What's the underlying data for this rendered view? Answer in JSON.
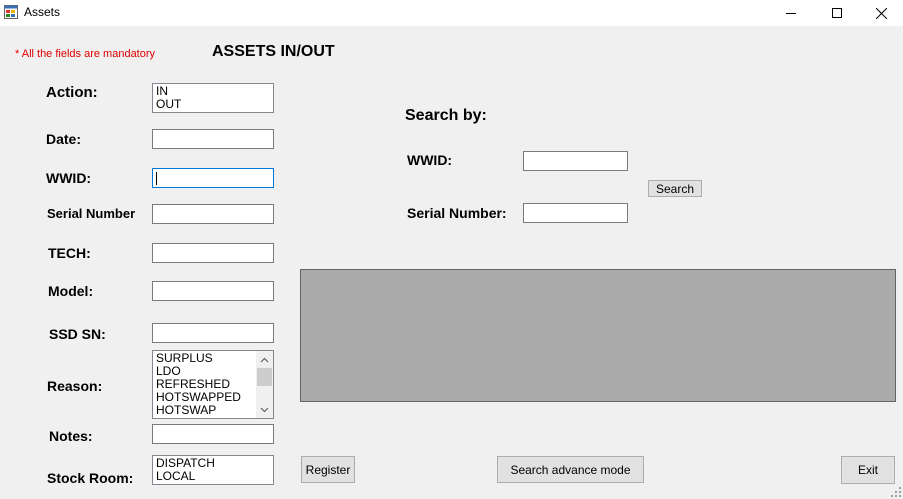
{
  "window": {
    "title": "Assets"
  },
  "form": {
    "mandatory_note": "* All the fields are mandatory",
    "heading": "ASSETS IN/OUT",
    "labels": {
      "action": "Action:",
      "date": "Date:",
      "wwid": "WWID:",
      "serial_number": "Serial Number",
      "tech": "TECH:",
      "model": "Model:",
      "ssd_sn": "SSD SN:",
      "reason": "Reason:",
      "notes": "Notes:",
      "stock_room": "Stock Room:"
    },
    "values": {
      "date": "",
      "wwid": "",
      "serial_number": "",
      "tech": "",
      "model": "",
      "ssd_sn": "",
      "notes": ""
    },
    "action_options": [
      "IN",
      "OUT"
    ],
    "reason_options": [
      "SURPLUS",
      "LDO",
      "REFRESHED",
      "HOTSWAPPED",
      "HOTSWAP"
    ],
    "stock_room_options": [
      "DISPATCH",
      "LOCAL"
    ]
  },
  "search": {
    "title": "Search by:",
    "wwid_label": "WWID:",
    "serial_label": "Serial Number:",
    "wwid_value": "",
    "serial_value": "",
    "button": "Search"
  },
  "buttons": {
    "register": "Register",
    "advance": "Search advance mode",
    "exit": "Exit"
  },
  "icons": {
    "app": "app-window-icon",
    "minimize": "minimize-icon",
    "maximize": "maximize-icon",
    "close": "close-icon",
    "scroll_up": "chevron-up-icon",
    "scroll_down": "chevron-down-icon",
    "grip": "resize-grip-icon"
  }
}
